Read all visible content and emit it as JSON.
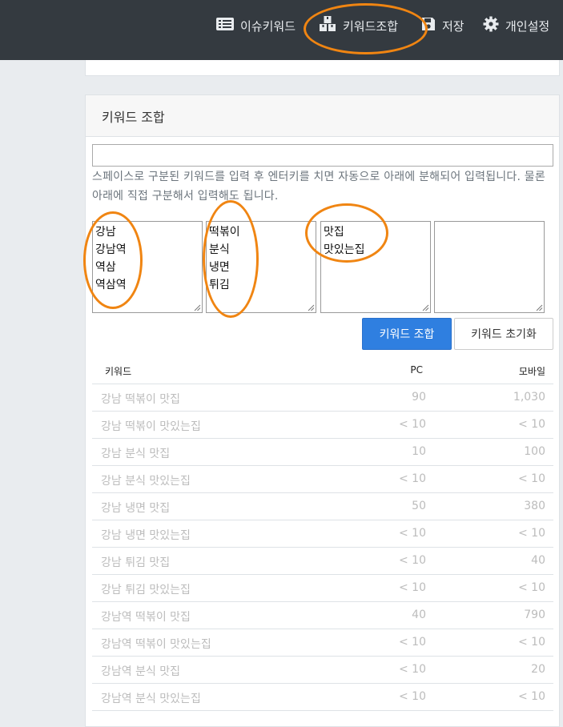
{
  "nav": {
    "items": [
      {
        "label": "이슈키워드",
        "icon": "list-icon"
      },
      {
        "label": "키워드조합",
        "icon": "cubes-icon"
      },
      {
        "label": "저장",
        "icon": "save-icon"
      },
      {
        "label": "개인설정",
        "icon": "gear-icon"
      }
    ]
  },
  "card": {
    "title": "키워드 조합",
    "input_value": "",
    "help_text": "스페이스로 구분된 키워드를 입력 후 엔터키를 치면 자동으로 아래에 분해되어 입력됩니다. 물론 아래에 직접 구분해서 입력해도 됩니다.",
    "boxes": [
      {
        "lines": [
          "강남",
          "강남역",
          "역삼",
          "역삼역"
        ]
      },
      {
        "lines": [
          "떡볶이",
          "분식",
          "냉면",
          "튀김"
        ]
      },
      {
        "lines": [
          "맛집",
          "맛있는집"
        ]
      },
      {
        "lines": []
      }
    ],
    "combine_button": "키워드 조합",
    "reset_button": "키워드 초기화"
  },
  "table": {
    "headers": {
      "keyword": "키워드",
      "pc": "PC",
      "mobile": "모바일"
    },
    "rows": [
      {
        "keyword": "강남 떡볶이 맛집",
        "pc": "90",
        "mobile": "1,030"
      },
      {
        "keyword": "강남 떡볶이 맛있는집",
        "pc": "< 10",
        "mobile": "< 10"
      },
      {
        "keyword": "강남 분식 맛집",
        "pc": "10",
        "mobile": "100"
      },
      {
        "keyword": "강남 분식 맛있는집",
        "pc": "< 10",
        "mobile": "< 10"
      },
      {
        "keyword": "강남 냉면 맛집",
        "pc": "50",
        "mobile": "380"
      },
      {
        "keyword": "강남 냉면 맛있는집",
        "pc": "< 10",
        "mobile": "< 10"
      },
      {
        "keyword": "강남 튀김 맛집",
        "pc": "< 10",
        "mobile": "40"
      },
      {
        "keyword": "강남 튀김 맛있는집",
        "pc": "< 10",
        "mobile": "< 10"
      },
      {
        "keyword": "강남역 떡볶이 맛집",
        "pc": "40",
        "mobile": "790"
      },
      {
        "keyword": "강남역 떡볶이 맛있는집",
        "pc": "< 10",
        "mobile": "< 10"
      },
      {
        "keyword": "강남역 분식 맛집",
        "pc": "< 10",
        "mobile": "20"
      },
      {
        "keyword": "강남역 분식 맛있는집",
        "pc": "< 10",
        "mobile": "< 10"
      }
    ]
  },
  "colors": {
    "nav_bg": "#343a40",
    "primary": "#2f7fe0",
    "annotation": "#f08512",
    "muted_text": "#bcbcbc"
  }
}
